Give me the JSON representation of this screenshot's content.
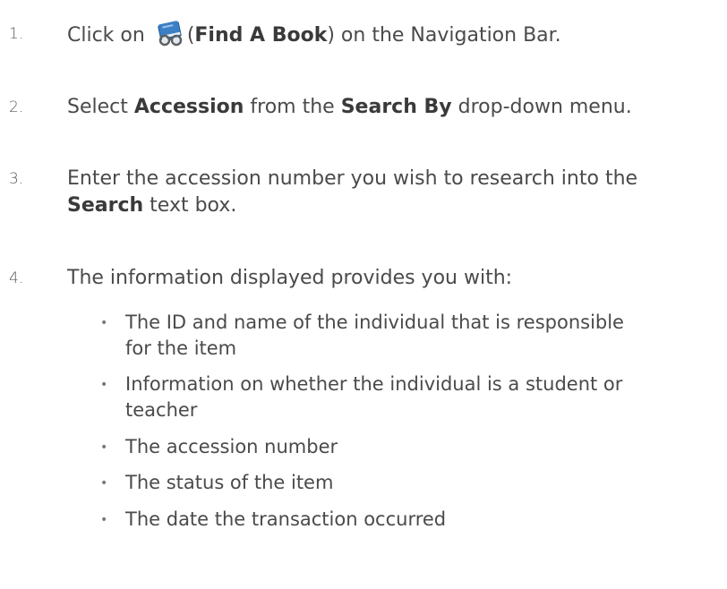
{
  "steps": [
    {
      "number": "1.",
      "before": "Click on ",
      "paren_open": "(",
      "bold": "Find A Book",
      "after": ") on the Navigation Bar."
    },
    {
      "number": "2.",
      "pre": "Select ",
      "bold1": "Accession",
      "mid": " from the ",
      "bold2": "Search By",
      "post": " drop-down menu."
    },
    {
      "number": "3.",
      "line1": "Enter the accession number you wish to research into the",
      "bold": "Search",
      "line2_rest": " text box."
    },
    {
      "number": "4.",
      "line1": "The information displayed provides you with:"
    }
  ],
  "bullets": [
    {
      "line1": "The ID and name of the individual that is responsible",
      "line2": "for the item"
    },
    {
      "line1": "Information on whether the individual is a student or",
      "line2": "teacher"
    },
    {
      "line1": "The accession number"
    },
    {
      "line1": "The status of the item"
    },
    {
      "line1": "The date the transaction occurred"
    }
  ],
  "bullet_glyph": "•",
  "icon": {
    "name": "find-a-book-icon",
    "colors": {
      "book": "#3b7fc4",
      "book_dark": "#1f5a9a",
      "glasses": "#6b6b6b"
    }
  }
}
